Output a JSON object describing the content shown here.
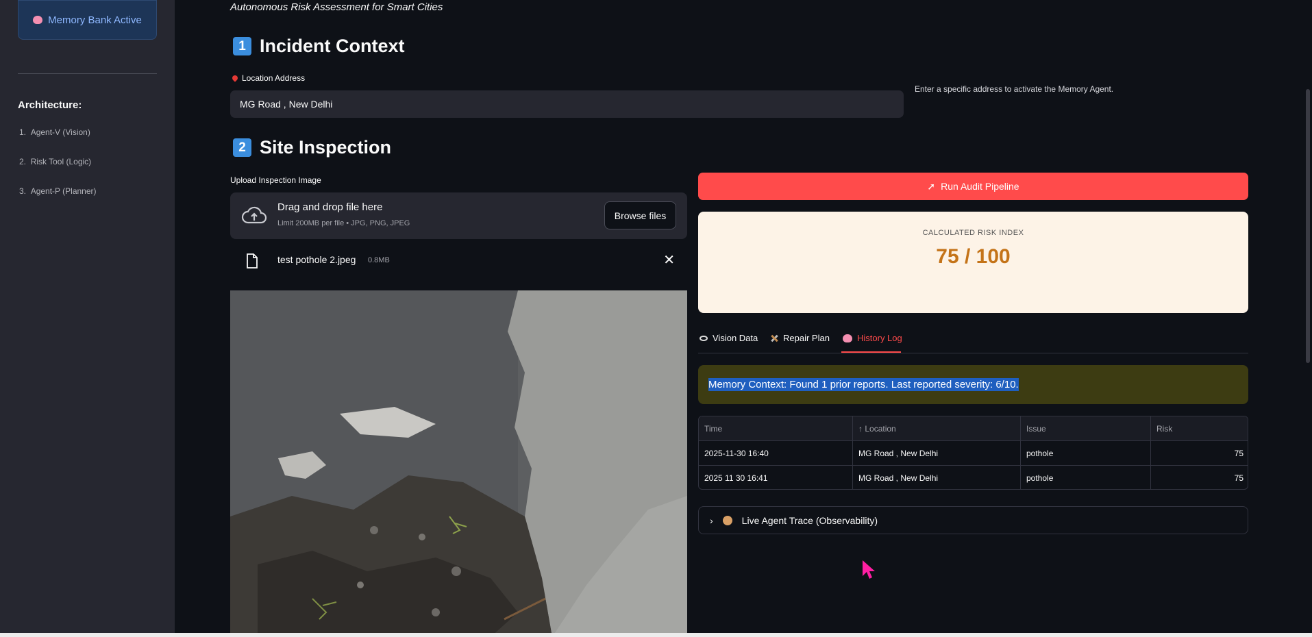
{
  "sidebar": {
    "memory_badge": "Memory Bank Active",
    "architecture_title": "Architecture:",
    "architecture_items": [
      "Agent-V (Vision)",
      "Risk Tool (Logic)",
      "Agent-P (Planner)"
    ]
  },
  "header": {
    "subtitle": "Autonomous Risk Assessment for Smart Cities"
  },
  "incident": {
    "section_number": "1",
    "section_title": "Incident Context",
    "location_label": "Location Address",
    "location_value": "MG Road , New Delhi",
    "help_text": "Enter a specific address to activate the Memory Agent."
  },
  "inspection": {
    "section_number": "2",
    "section_title": "Site Inspection",
    "upload_label": "Upload Inspection Image",
    "drop_text": "Drag and drop file here",
    "drop_limit": "Limit 200MB per file • JPG, PNG, JPEG",
    "browse_label": "Browse files",
    "file_name": "test pothole 2.jpeg",
    "file_size": "0.8MB"
  },
  "pipeline": {
    "run_button": "Run Audit Pipeline",
    "risk_label": "CALCULATED RISK INDEX",
    "risk_value": "75 / 100"
  },
  "tabs": [
    {
      "label": "Vision Data",
      "active": false
    },
    {
      "label": "Repair Plan",
      "active": false
    },
    {
      "label": "History Log",
      "active": true
    }
  ],
  "memory_context": "Memory Context: Found 1 prior reports. Last reported severity: 6/10.",
  "history_table": {
    "columns": [
      "Time",
      "Location",
      "Issue",
      "Risk"
    ],
    "sorted_column_indicator": "↑",
    "rows": [
      [
        "2025-11-30 16:40",
        "MG Road , New Delhi",
        "pothole",
        "75"
      ],
      [
        "2025 11 30 16:41",
        "MG Road , New Delhi",
        "pothole",
        "75"
      ]
    ]
  },
  "trace_expander": "Live Agent Trace (Observability)",
  "colors": {
    "accent": "#ff4b4b",
    "background": "#0e1117",
    "sidebar": "#262730",
    "risk_value": "#c47318",
    "memory_banner": "#3d3c12"
  }
}
